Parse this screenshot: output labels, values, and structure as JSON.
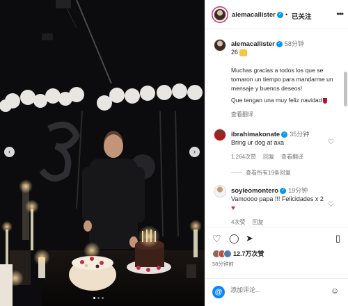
{
  "post": {
    "username": "alemacallister",
    "follow_status": "已关注",
    "dot": "•",
    "more": "•••"
  },
  "caption": {
    "username": "alemacallister",
    "time": "58分钟",
    "line1": "26",
    "text": "Muchas gracias a todos los que se tomaron un tiempo para mandarme un mensaje y buenos deseos!",
    "wish": "Que tengan una muy feliz navidad",
    "translate": "查看翻译"
  },
  "comments": [
    {
      "username": "ibrahimakonate",
      "time": "35分钟",
      "text": "Bring ur dog at axa",
      "likes": "1,264次赞",
      "reply": "回复",
      "translate": "查看翻译",
      "view_replies": "查看所有19条回复"
    },
    {
      "username": "soyleomontero",
      "time": "19分钟",
      "text": "Vamoooo papa !!! Felicidades x 2",
      "emoji": "♥",
      "likes": "4次赞",
      "reply": "回复"
    }
  ],
  "actions": {
    "likes": "12.7万次赞",
    "time": "58分钟前"
  },
  "composer": {
    "placeholder": "添加评论..."
  },
  "icons": {
    "verified": "✓",
    "heart": "♡",
    "like": "♡",
    "comment": "◯",
    "share": "➤",
    "save": "▯",
    "emoji": "☺",
    "threads": "@",
    "prev": "‹",
    "next": "›"
  },
  "colors": {
    "accent": "#0095f6",
    "text": "#262626",
    "muted": "#737373",
    "photo_bg": "#0b0a0c"
  }
}
